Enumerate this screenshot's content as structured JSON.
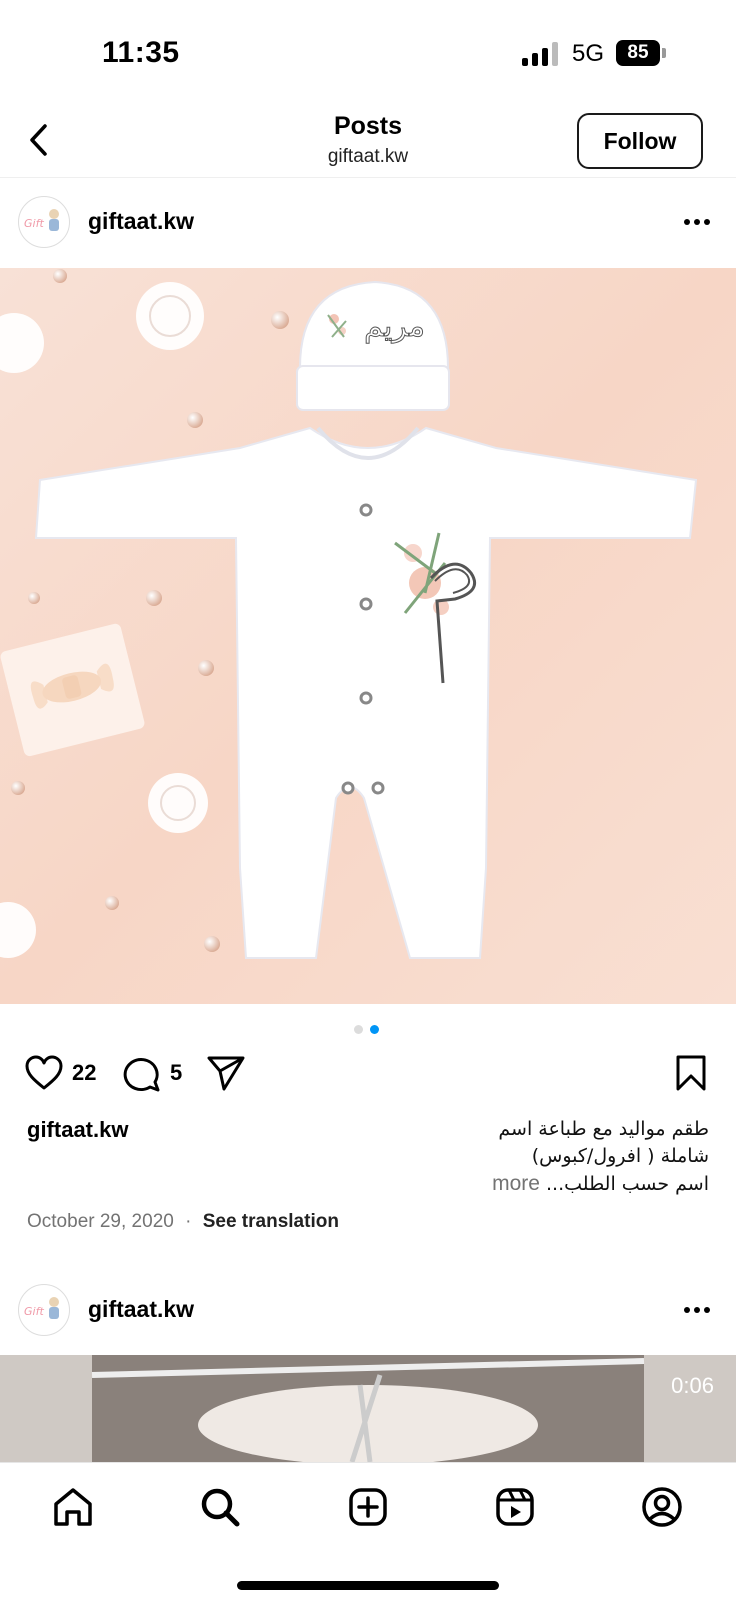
{
  "status_bar": {
    "time": "11:35",
    "network": "5G",
    "battery": "85"
  },
  "header": {
    "title": "Posts",
    "subtitle": "giftaat.kw",
    "follow_label": "Follow"
  },
  "post": {
    "username": "giftaat.kw",
    "image_text": "مريم",
    "carousel": {
      "count": 2,
      "active_index": 1
    },
    "likes": "22",
    "comments": "5",
    "caption_username": "giftaat.kw",
    "caption_line1": "طقم مواليد مع طباعة اسم",
    "caption_line2": "شاملة ( افرول/كبوس)",
    "caption_line3": "اسم حسب الطلب...",
    "more_label": "more",
    "date": "October 29, 2020",
    "separator": "·",
    "see_translation": "See translation"
  },
  "next_post": {
    "username": "giftaat.kw",
    "duration": "0:06"
  },
  "tabs": [
    "home-icon",
    "search-icon",
    "create-icon",
    "reels-icon",
    "profile-icon"
  ],
  "colors": {
    "accent_blue": "#0095f6",
    "muted": "#737373",
    "media_bg": "#f6d9cc"
  }
}
